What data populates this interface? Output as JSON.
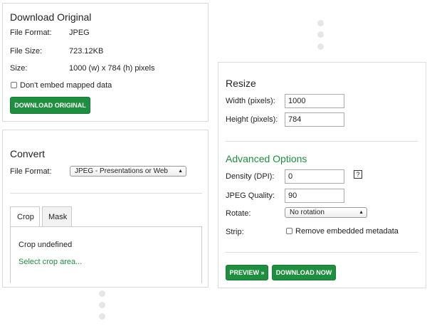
{
  "download_original": {
    "title": "Download Original",
    "file_format_label": "File Format:",
    "file_format_value": "JPEG",
    "file_size_label": "File Size:",
    "file_size_value": "723.12KB",
    "size_label": "Size:",
    "size_value": "1000 (w) x 784 (h) pixels",
    "embed_checkbox_label": "Don't embed mapped data",
    "button_label": "DOWNLOAD ORIGINAL"
  },
  "convert": {
    "title": "Convert",
    "file_format_label": "File Format:",
    "file_format_selected": "JPEG - Presentations or Web",
    "tabs": [
      {
        "label": "Crop",
        "active": true
      },
      {
        "label": "Mask",
        "active": false
      }
    ],
    "crop_status": "Crop undefined",
    "select_crop_link": "Select crop area..."
  },
  "resize": {
    "title": "Resize",
    "width_label": "Width (pixels):",
    "width_value": "1000",
    "height_label": "Height (pixels):",
    "height_value": "784"
  },
  "advanced": {
    "title": "Advanced Options",
    "density_label": "Density (DPI):",
    "density_value": "0",
    "help_icon_text": "?",
    "quality_label": "JPEG Quality:",
    "quality_value": "90",
    "rotate_label": "Rotate:",
    "rotate_selected": "No rotation",
    "strip_label": "Strip:",
    "strip_checkbox_label": "Remove embedded metadata",
    "preview_button": "PREVIEW »",
    "download_button": "DOWNLOAD NOW"
  },
  "colors": {
    "accent_green": "#1e8f3e",
    "panel_border": "#dcdcdc",
    "dot_gray": "#e6e6e6"
  },
  "icons": {
    "dropdown": "chevron-updown-icon",
    "help": "help-icon"
  }
}
